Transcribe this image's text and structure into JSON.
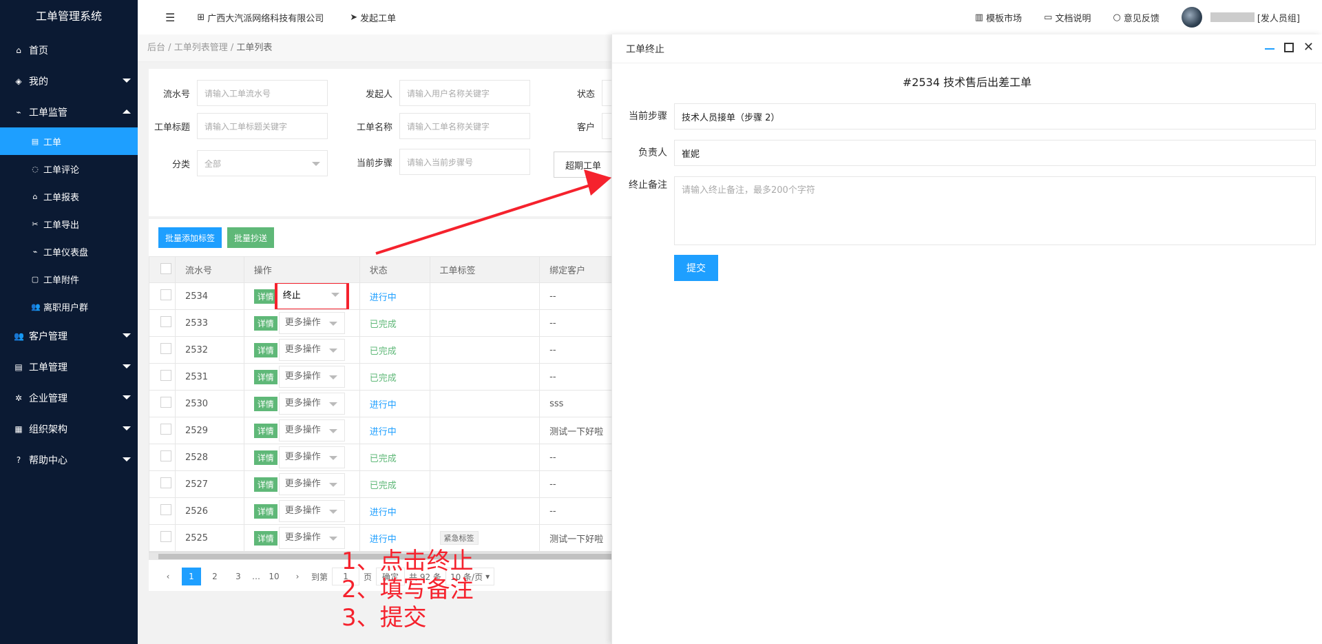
{
  "app": {
    "title": "工单管理系统"
  },
  "topbar": {
    "org": "广西大汽派网络科技有限公司",
    "launch": "发起工单",
    "template_market": "模板市场",
    "docs": "文档说明",
    "feedback": "意见反馈",
    "user_group": "[发人员组]"
  },
  "sidebar": {
    "items": [
      {
        "label": "首页"
      },
      {
        "label": "我的"
      },
      {
        "label": "工单监管"
      },
      {
        "label": "客户管理"
      },
      {
        "label": "工单管理"
      },
      {
        "label": "企业管理"
      },
      {
        "label": "组织架构"
      },
      {
        "label": "帮助中心"
      }
    ],
    "sub": [
      {
        "label": "工单"
      },
      {
        "label": "工单评论"
      },
      {
        "label": "工单报表"
      },
      {
        "label": "工单导出"
      },
      {
        "label": "工单仪表盘"
      },
      {
        "label": "工单附件"
      },
      {
        "label": "离职用户群"
      }
    ]
  },
  "breadcrumb": {
    "home": "后台",
    "sep": "/",
    "mid": "工单列表管理",
    "current": "工单列表"
  },
  "filter": {
    "serial_label": "流水号",
    "serial_ph": "请输入工单流水号",
    "initiator_label": "发起人",
    "initiator_ph": "请输入用户名称关键字",
    "status_label": "状态",
    "title_label": "工单标题",
    "title_ph": "请输入工单标题关键字",
    "name_label": "工单名称",
    "name_ph": "请输入工单名称关键字",
    "customer_label": "客户",
    "category_label": "分类",
    "category_value": "全部",
    "step_label": "当前步骤",
    "step_ph": "请输入当前步骤号",
    "overdue_btn": "超期工单"
  },
  "toolbar": {
    "batch_tag": "批量添加标签",
    "batch_cc": "批量抄送"
  },
  "table": {
    "headers": {
      "serial": "流水号",
      "op": "操作",
      "status": "状态",
      "tags": "工单标签",
      "customer": "绑定客户"
    },
    "detail_label": "详情",
    "rows": [
      {
        "serial": "2534",
        "op": "终止",
        "status": "进行中",
        "tag": "",
        "customer": "--"
      },
      {
        "serial": "2533",
        "op": "更多操作",
        "status": "已完成",
        "tag": "",
        "customer": "--"
      },
      {
        "serial": "2532",
        "op": "更多操作",
        "status": "已完成",
        "tag": "",
        "customer": "--"
      },
      {
        "serial": "2531",
        "op": "更多操作",
        "status": "已完成",
        "tag": "",
        "customer": "--"
      },
      {
        "serial": "2530",
        "op": "更多操作",
        "status": "进行中",
        "tag": "",
        "customer": "sss"
      },
      {
        "serial": "2529",
        "op": "更多操作",
        "status": "进行中",
        "tag": "",
        "customer": "测试一下好啦"
      },
      {
        "serial": "2528",
        "op": "更多操作",
        "status": "已完成",
        "tag": "",
        "customer": "--"
      },
      {
        "serial": "2527",
        "op": "更多操作",
        "status": "已完成",
        "tag": "",
        "customer": "--"
      },
      {
        "serial": "2526",
        "op": "更多操作",
        "status": "进行中",
        "tag": "",
        "customer": "--"
      },
      {
        "serial": "2525",
        "op": "更多操作",
        "status": "进行中",
        "tag": "紧急标签",
        "customer": "测试一下好啦"
      }
    ]
  },
  "pager": {
    "pages": [
      "1",
      "2",
      "3"
    ],
    "ellipsis": "…",
    "last": "10",
    "goto": "到第",
    "goto_value": "1",
    "page_unit": "页",
    "confirm": "确定",
    "total": "共 92 条",
    "size": "10 条/页"
  },
  "steps": [
    "1、点击终止",
    "2、填写备注",
    "3、提交"
  ],
  "panel": {
    "head": "工单终止",
    "title": "#2534 技术售后出差工单",
    "step_label": "当前步骤",
    "step_value": "技术人员接单（步骤 2）",
    "owner_label": "负责人",
    "owner_value": "崔妮",
    "remark_label": "终止备注",
    "remark_ph": "请输入终止备注，最多200个字符",
    "submit": "提交"
  },
  "colors": {
    "accent": "#1e9fff",
    "success": "#5fb878",
    "sidebar": "#0b1a33",
    "annotation": "#f5222d"
  }
}
